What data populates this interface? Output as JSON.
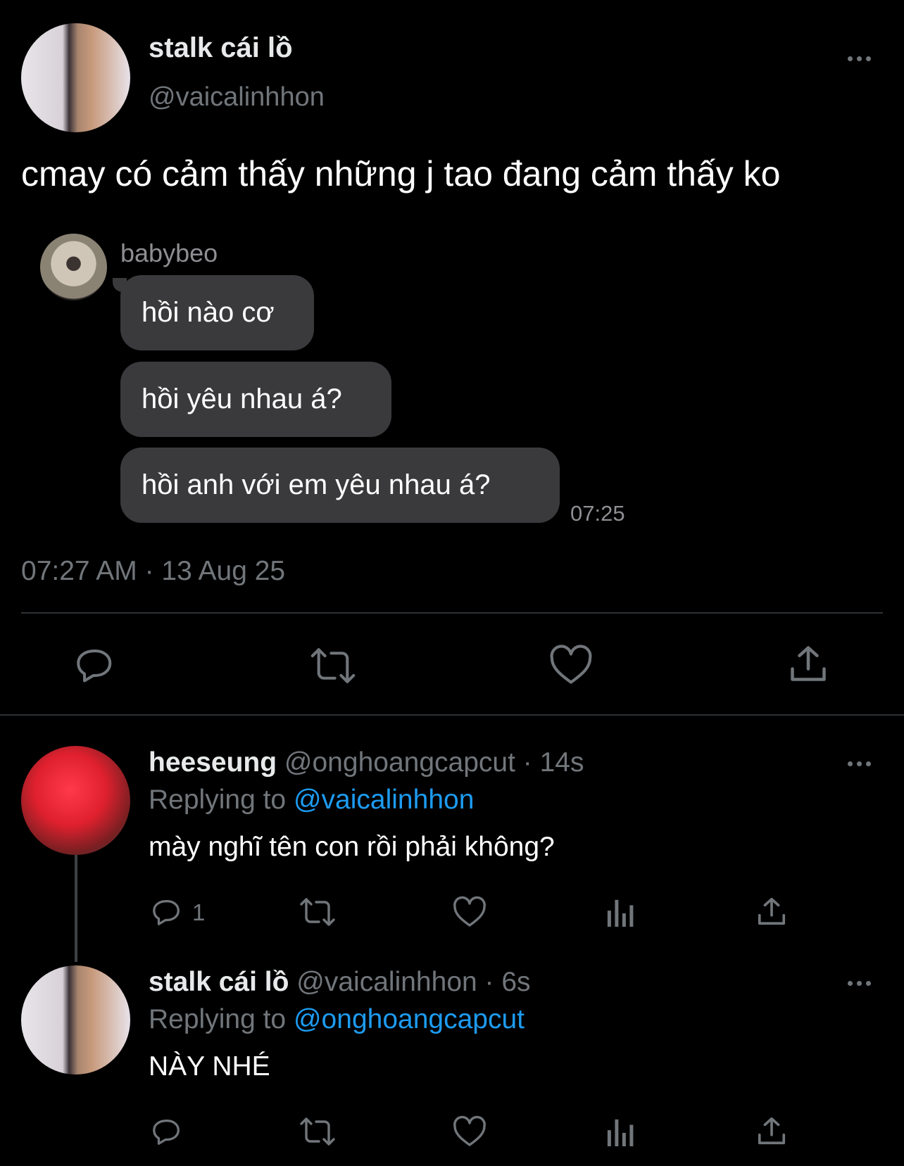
{
  "main_tweet": {
    "display_name": "stalk cái lồ",
    "handle": "@vaicalinhhon",
    "text": "cmay có cảm thấy những j tao đang cảm thấy ko",
    "embedded_chat": {
      "sender": "babybeo",
      "messages": [
        "hồi nào cơ",
        "hồi yêu nhau á?",
        "hồi anh với em yêu nhau á?"
      ],
      "time": "07:25"
    },
    "timestamp": "07:27 AM · 13 Aug 25"
  },
  "replies": [
    {
      "display_name": "heeseung",
      "handle": "@onghoangcapcut",
      "age": "· 14s",
      "replying_prefix": "Replying to",
      "replying_to": "@vaicalinhhon",
      "text": "mày nghĩ tên con rồi phải không?",
      "reply_count": "1"
    },
    {
      "display_name": "stalk cái lồ",
      "handle": "@vaicalinhhon",
      "age": "· 6s",
      "replying_prefix": "Replying to",
      "replying_to": "@onghoangcapcut",
      "text": "NÀY NHÉ",
      "reply_count": ""
    }
  ],
  "icons": {
    "reply": "reply-icon",
    "retweet": "retweet-icon",
    "like": "heart-icon",
    "views": "views-icon",
    "share": "share-icon",
    "more": "more-icon"
  },
  "colors": {
    "background": "#000000",
    "text": "#e7e9ea",
    "muted": "#71767b",
    "link": "#1d9bf0",
    "bubble": "#3a3a3c"
  }
}
